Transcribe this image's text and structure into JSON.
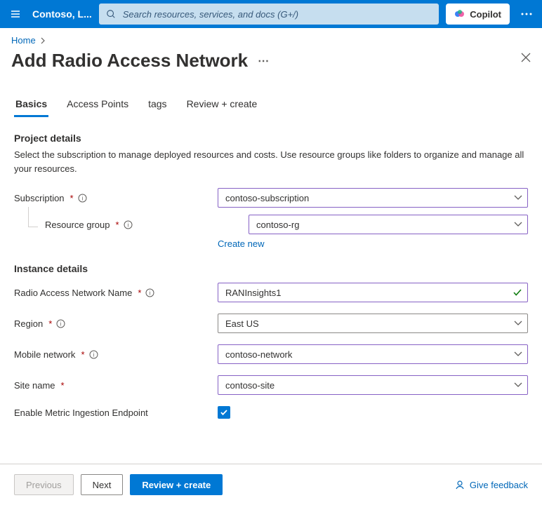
{
  "topbar": {
    "tenant": "Contoso, L...",
    "search_placeholder": "Search resources, services, and docs (G+/)",
    "copilot_label": "Copilot"
  },
  "breadcrumb": {
    "home": "Home"
  },
  "page": {
    "title": "Add Radio Access Network"
  },
  "tabs": {
    "basics": "Basics",
    "access_points": "Access Points",
    "tags": "tags",
    "review": "Review + create"
  },
  "project": {
    "heading": "Project details",
    "description": "Select the subscription to manage deployed resources and costs. Use resource groups like folders to organize and manage all your resources.",
    "subscription_label": "Subscription",
    "subscription_value": "contoso-subscription",
    "rg_label": "Resource group",
    "rg_value": "contoso-rg",
    "create_new": "Create new"
  },
  "instance": {
    "heading": "Instance details",
    "ran_label": "Radio Access Network Name",
    "ran_value": "RANInsights1",
    "region_label": "Region",
    "region_value": "East US",
    "mobile_label": "Mobile network",
    "mobile_value": "contoso-network",
    "site_label": "Site name",
    "site_value": "contoso-site",
    "enable_label": "Enable Metric Ingestion Endpoint"
  },
  "footer": {
    "previous": "Previous",
    "next": "Next",
    "review": "Review + create",
    "feedback": "Give feedback"
  }
}
